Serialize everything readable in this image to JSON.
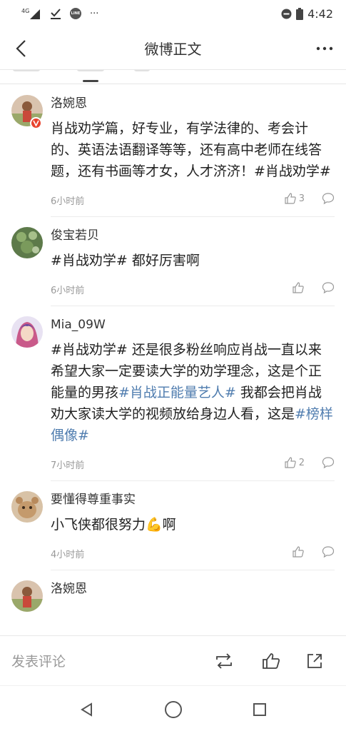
{
  "status_bar": {
    "network": "4G",
    "more": "···",
    "line_badge": "LINE",
    "time": "4:42"
  },
  "header": {
    "title": "微博正文"
  },
  "comments": [
    {
      "user": "洛婉恩",
      "text": "肖战劝学篇，好专业，有学法律的、考会计的、英语法语翻译等等，还有高中老师在线答题，还有书画等才女，人才济济！#肖战劝学#",
      "time": "6小时前",
      "likes": "3"
    },
    {
      "user": "俊宝若贝",
      "text_parts": [
        "#肖战劝学#",
        " 都好厉害啊"
      ],
      "time": "6小时前",
      "likes": ""
    },
    {
      "user": "Mia_09W",
      "text_parts": [
        "#肖战劝学# 还是很多粉丝响应肖战一直以来希望大家一定要读大学的劝学理念，这是个正能量的男孩",
        "#肖战正能量艺人#",
        " 我都会把肖战劝大家读大学的视频放给身边人看，这是",
        "#榜样偶像#"
      ],
      "time": "7小时前",
      "likes": "2"
    },
    {
      "user": "要懂得尊重事实",
      "text": "小飞侠都很努力💪啊",
      "time": "4小时前",
      "likes": ""
    },
    {
      "user": "洛婉恩"
    }
  ],
  "bottom_bar": {
    "compose_placeholder": "发表评论"
  },
  "icons": {
    "back": "chevron-left-icon",
    "more": "more-dots-icon",
    "like": "thumb-up-icon",
    "reply": "comment-bubble-icon",
    "repost": "repost-icon",
    "share": "share-icon"
  },
  "colors": {
    "link": "#507daf",
    "muted": "#999999",
    "verified": "#e8432e"
  }
}
